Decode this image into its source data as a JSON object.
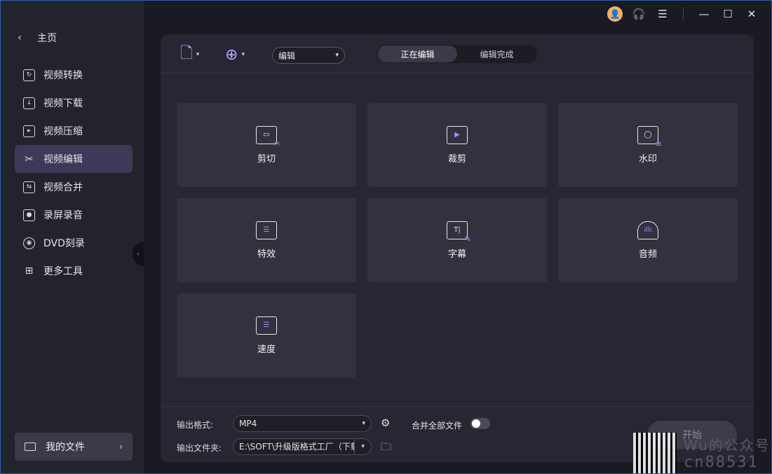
{
  "titlebar": {
    "icons": [
      "user-avatar-icon",
      "headset-icon",
      "menu-icon",
      "minimize-icon",
      "maximize-icon",
      "close-icon"
    ]
  },
  "sidebar": {
    "home_label": "主页",
    "items": [
      {
        "label": "视频转换",
        "icon": "video-convert-icon"
      },
      {
        "label": "视频下载",
        "icon": "download-icon"
      },
      {
        "label": "视频压缩",
        "icon": "compress-icon"
      },
      {
        "label": "视频编辑",
        "icon": "scissors-icon",
        "active": true
      },
      {
        "label": "视频合并",
        "icon": "merge-icon"
      },
      {
        "label": "录屏录音",
        "icon": "screen-record-icon"
      },
      {
        "label": "DVD刻录",
        "icon": "dvd-icon"
      },
      {
        "label": "更多工具",
        "icon": "more-tools-icon"
      }
    ],
    "my_files_label": "我的文件"
  },
  "toolbar": {
    "mode_value": "编辑",
    "tabs": [
      "正在编辑",
      "编辑完成"
    ],
    "active_tab": "正在编辑"
  },
  "tools": [
    {
      "label": "剪切",
      "icon": "cut-icon"
    },
    {
      "label": "裁剪",
      "icon": "crop-icon"
    },
    {
      "label": "水印",
      "icon": "watermark-icon"
    },
    {
      "label": "特效",
      "icon": "effects-icon"
    },
    {
      "label": "字幕",
      "icon": "subtitle-icon"
    },
    {
      "label": "音频",
      "icon": "audio-icon"
    },
    {
      "label": "速度",
      "icon": "speed-icon"
    }
  ],
  "footer": {
    "format_label": "输出格式:",
    "format_value": "MP4",
    "folder_label": "输出文件夹:",
    "folder_value": "E:\\SOFT\\升级版格式工厂（下载",
    "merge_label": "合并全部文件",
    "merge_on": false,
    "start_label": "开始"
  },
  "watermark": {
    "line1": "Wu的公众号",
    "line2": "cn88531"
  },
  "colors": {
    "accent": "#a78bfa",
    "active_nav": "#3c3a58",
    "panel": "#272733",
    "tile": "#32323f"
  }
}
